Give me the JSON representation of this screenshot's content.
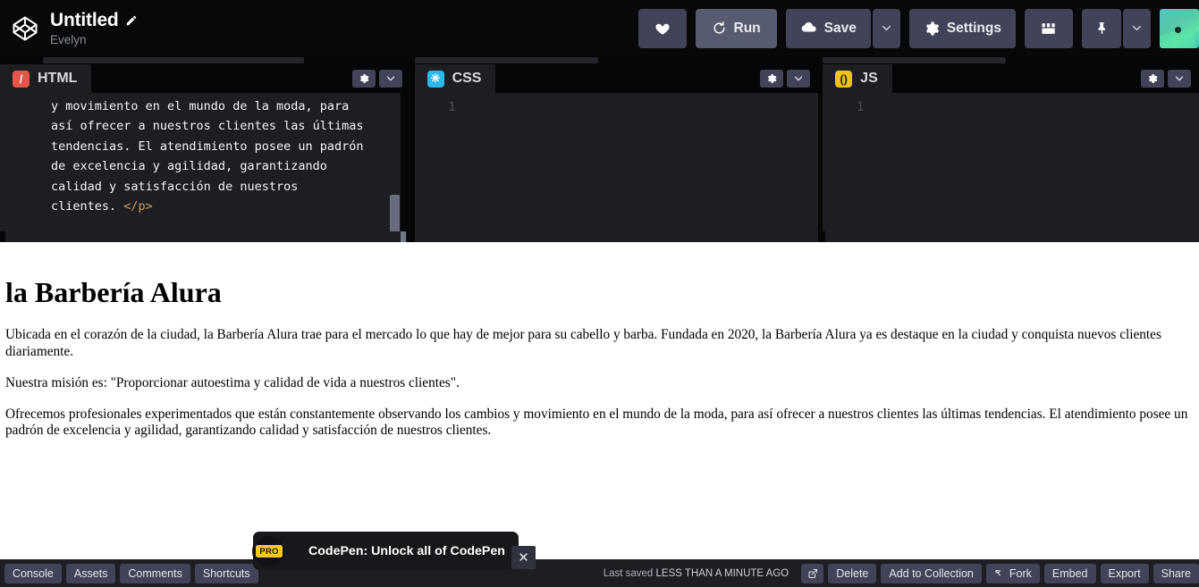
{
  "header": {
    "logo_icon": "codepen-cube-icon",
    "pen_title": "Untitled",
    "edit_icon": "pencil-icon",
    "author": "Evelyn",
    "buttons": {
      "heart": {
        "label": "",
        "icon": "heart-icon"
      },
      "run": {
        "label": "Run",
        "icon": "refresh-icon"
      },
      "save": {
        "label": "Save",
        "icon": "cloud-icon"
      },
      "save_caret": {
        "icon": "chevron-down-icon"
      },
      "settings": {
        "label": "Settings",
        "icon": "gear-icon"
      },
      "layout": {
        "icon": "layout-grid-icon"
      },
      "pin": {
        "icon": "pin-icon"
      },
      "pin_caret": {
        "icon": "chevron-down-icon"
      },
      "avatar": {
        "icon": "user-avatar"
      }
    }
  },
  "editors": [
    {
      "id": "html",
      "label": "HTML",
      "badge_glyph": "/",
      "badge_color": "#e4564a",
      "gear_icon": "gear-icon",
      "caret_icon": "chevron-down-icon",
      "code_lines": [
        "y movimiento en el mundo de la moda, para",
        "así ofrecer a nuestros clientes las últimas",
        "tendencias. El atendimiento posee un padrón",
        "de excelencia y agilidad, garantizando",
        "calidad y satisfacción de nuestros",
        "clientes. "
      ],
      "closing_tag": "</p>",
      "line_number": ""
    },
    {
      "id": "css",
      "label": "CSS",
      "badge_glyph": "✳",
      "badge_color": "#2cb8e8",
      "gear_icon": "gear-icon",
      "caret_icon": "chevron-down-icon",
      "code_lines": [],
      "closing_tag": "",
      "line_number": "1"
    },
    {
      "id": "js",
      "label": "JS",
      "badge_glyph": "()",
      "badge_color": "#f0c11b",
      "gear_icon": "gear-icon",
      "caret_icon": "chevron-down-icon",
      "code_lines": [],
      "closing_tag": "",
      "line_number": "1"
    }
  ],
  "preview": {
    "heading": "la Barbería Alura",
    "paragraphs": [
      "Ubicada en el corazón de la ciudad, la Barbería Alura trae para el mercado lo que hay de mejor para su cabello y barba. Fundada en 2020, la Barbería Alura ya es destaque en la ciudad y conquista nuevos clientes diariamente.",
      "Nuestra misión es: \"Proporcionar autoestima y calidad de vida a nuestros clientes\".",
      "Ofrecemos profesionales experimentados que están constantemente observando los cambios y movimiento en el mundo de la moda, para así ofrecer a nuestros clientes las últimas tendencias. El atendimiento posee un padrón de excelencia y agilidad, garantizando calidad y satisfacción de nuestros clientes."
    ]
  },
  "bottombar": {
    "left_buttons": [
      {
        "label": "Console"
      },
      {
        "label": "Assets"
      },
      {
        "label": "Comments"
      },
      {
        "label": "Shortcuts"
      }
    ],
    "saved_prefix": "Last saved ",
    "saved_value": "LESS THAN A MINUTE AGO",
    "right_buttons": [
      {
        "label": "",
        "icon": "external-link-icon"
      },
      {
        "label": "Delete",
        "icon": ""
      },
      {
        "label": "Add to Collection",
        "icon": ""
      },
      {
        "label": "Fork",
        "icon": "fork-icon"
      },
      {
        "label": "Embed",
        "icon": ""
      },
      {
        "label": "Export",
        "icon": ""
      },
      {
        "label": "Share",
        "icon": ""
      }
    ]
  },
  "pro_ad": {
    "badge_text": "PRO",
    "message": "CodePen: Unlock all of CodePen",
    "close_icon": "close-icon",
    "close_glyph": "✕"
  },
  "colors": {
    "header_bg": "#080808",
    "panel_bg": "#1d1e22",
    "button_bg": "#414458",
    "run_bg": "#575b70",
    "accent_yellow": "#f4c824",
    "html_red": "#e4564a",
    "css_blue": "#2cb8e8",
    "js_yellow": "#f0c11b"
  }
}
